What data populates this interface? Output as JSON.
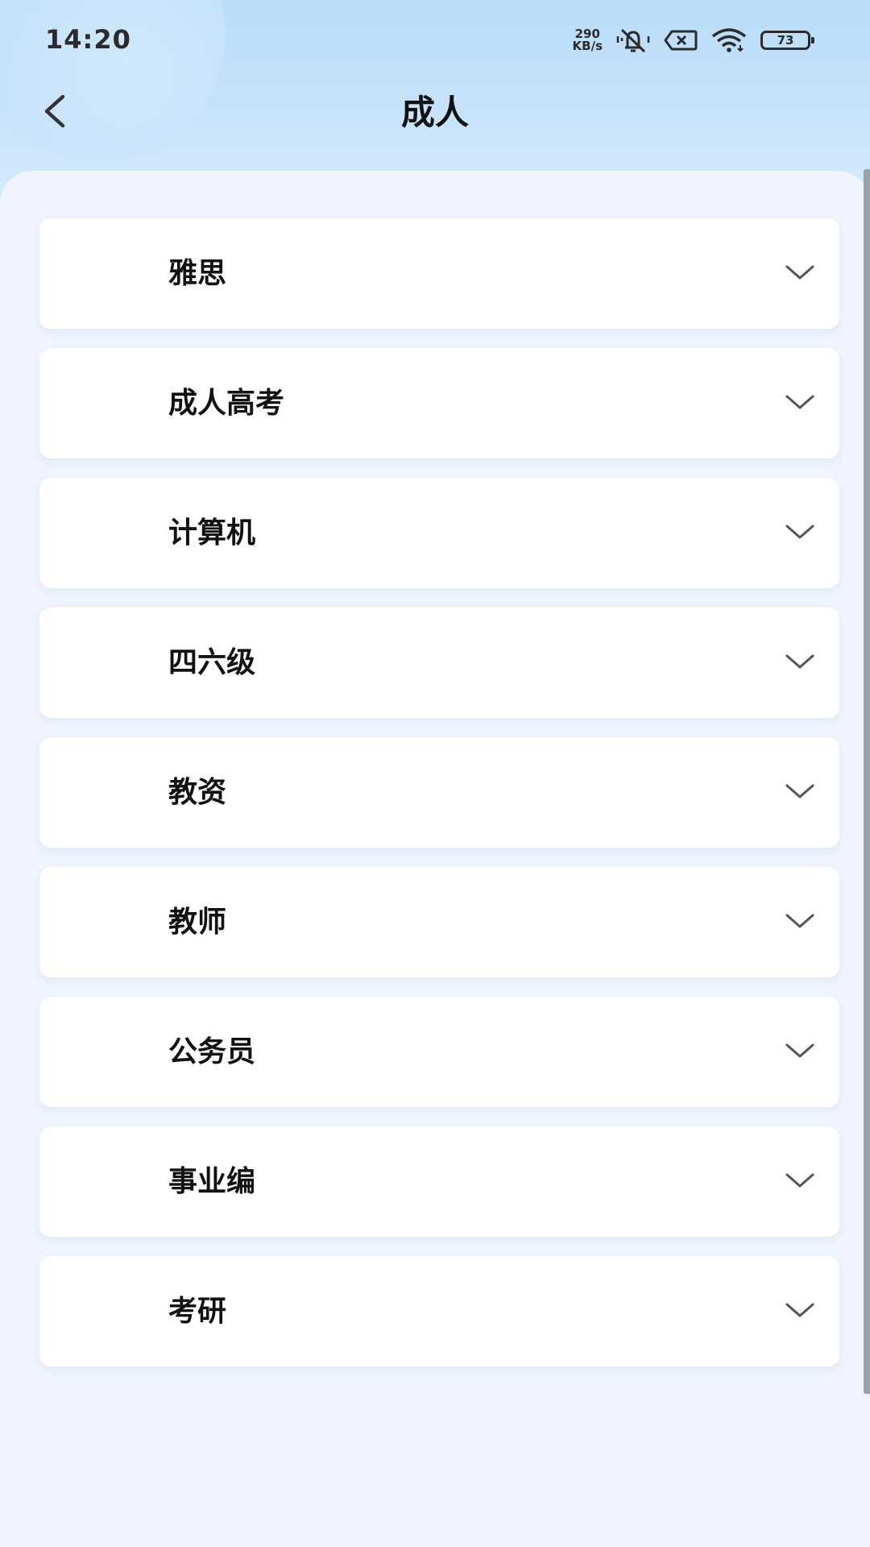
{
  "status_bar": {
    "time": "14:20",
    "net_speed_value": "290",
    "net_speed_unit": "KB/s",
    "battery_level": "73",
    "icons": [
      "mute-icon",
      "sim-disabled-icon",
      "wifi-icon",
      "battery-icon"
    ]
  },
  "header": {
    "title": "成人",
    "back_icon": "chevron-left-icon"
  },
  "categories": [
    {
      "label": "雅思"
    },
    {
      "label": "成人高考"
    },
    {
      "label": "计算机"
    },
    {
      "label": "四六级"
    },
    {
      "label": "教资"
    },
    {
      "label": "教师"
    },
    {
      "label": "公务员"
    },
    {
      "label": "事业编"
    },
    {
      "label": "考研"
    }
  ],
  "colors": {
    "header_gradient_top": "#b9dcf8",
    "page_background": "#eff4fe",
    "card_background": "#ffffff",
    "text_primary": "#111111",
    "chevron": "#555555"
  }
}
